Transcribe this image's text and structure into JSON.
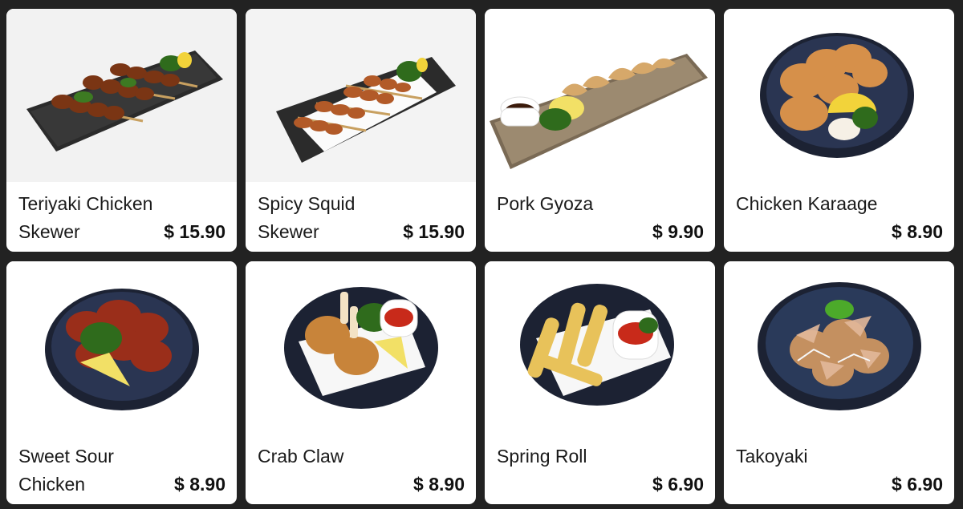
{
  "menu": {
    "items": [
      {
        "name": "Teriyaki Chicken Skewer",
        "price": "$ 15.90",
        "image": "teriyaki-chicken-skewer-photo"
      },
      {
        "name": "Spicy Squid Skewer",
        "price": "$ 15.90",
        "image": "spicy-squid-skewer-photo"
      },
      {
        "name": "Pork Gyoza",
        "price": "$ 9.90",
        "image": "pork-gyoza-photo"
      },
      {
        "name": "Chicken Karaage",
        "price": "$ 8.90",
        "image": "chicken-karaage-photo"
      },
      {
        "name": "Sweet Sour Chicken",
        "price": "$ 8.90",
        "image": "sweet-sour-chicken-photo"
      },
      {
        "name": "Crab Claw",
        "price": "$ 8.90",
        "image": "crab-claw-photo"
      },
      {
        "name": "Spring Roll",
        "price": "$ 6.90",
        "image": "spring-roll-photo"
      },
      {
        "name": "Takoyaki",
        "price": "$ 6.90",
        "image": "takoyaki-photo"
      }
    ]
  },
  "colors": {
    "background": "#222222",
    "card": "#ffffff",
    "text": "#1a1a1a"
  }
}
